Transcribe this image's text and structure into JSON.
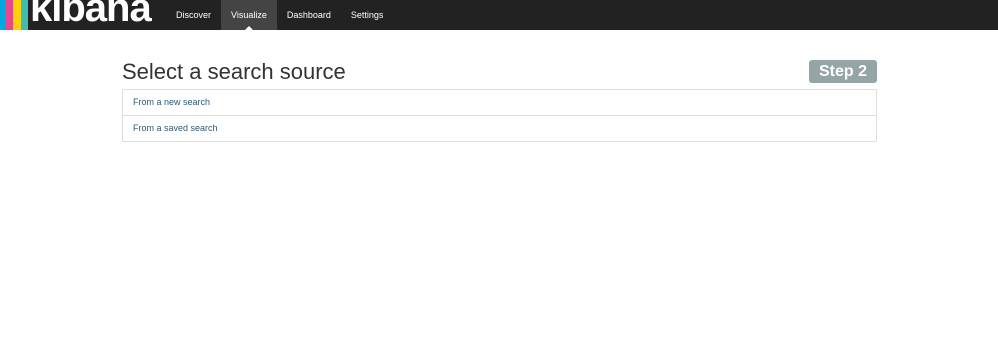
{
  "brand": {
    "name": "kibana",
    "stripe_colors": [
      "#00a9e0",
      "#e8478b",
      "#fed10a",
      "#3ebeb0"
    ]
  },
  "nav": {
    "items": [
      {
        "label": "Discover"
      },
      {
        "label": "Visualize"
      },
      {
        "label": "Dashboard"
      },
      {
        "label": "Settings"
      }
    ],
    "active": "Visualize"
  },
  "page": {
    "title": "Select a search source",
    "step_badge": "Step 2"
  },
  "sources": [
    {
      "label": "From a new search"
    },
    {
      "label": "From a saved search"
    }
  ],
  "colors": {
    "topbar": "#222222",
    "active_nav": "#444444",
    "badge": "#95a5a6",
    "link": "#2c5875",
    "border": "#dddddd"
  }
}
